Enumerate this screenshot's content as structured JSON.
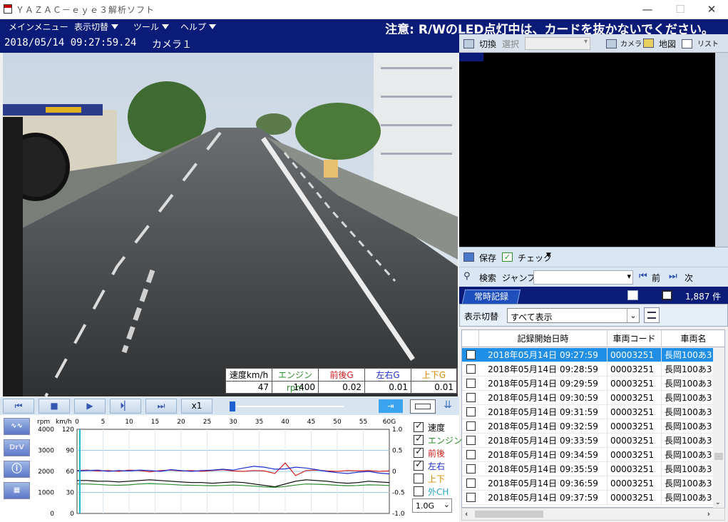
{
  "window": {
    "title": "ＹＡＺＡＣ－ｅｙｅ３解析ソフト",
    "minimize": "—",
    "maximize": "☐",
    "close": "✕"
  },
  "menu": {
    "items": [
      "メインメニュー",
      "表示切替",
      "ツール",
      "ヘルプ"
    ],
    "notice": "注意: R/WのLED点灯中は、カードを抜かないでください。"
  },
  "video": {
    "timestamp": "2018/05/14  09:27:59.24",
    "camera": "カメラ１"
  },
  "overlay": {
    "headers": [
      "速度km/h",
      "エンジン rpm",
      "前後G",
      "左右G",
      "上下G"
    ],
    "values": [
      "47",
      "1400",
      "0.02",
      "0.01",
      "0.01"
    ],
    "header_colors": [
      "#000000",
      "#2a8f2a",
      "#d42020",
      "#1e2ed0",
      "#e08a00"
    ]
  },
  "controls": {
    "speed": "x1",
    "buttons": [
      "⏮",
      "■",
      "▶",
      "⏵▏",
      "⏭"
    ]
  },
  "graph": {
    "left_units": [
      "rpm",
      "km/h"
    ],
    "rpm_ticks": [
      "4000",
      "3000",
      "2000",
      "1000",
      "0"
    ],
    "kmh_ticks": [
      "120",
      "90",
      "60",
      "30",
      "0"
    ],
    "g_ticks": [
      "1.0",
      "0.5",
      "0",
      "-0.5",
      "-1.0"
    ],
    "time_ticks": [
      "0",
      "5",
      "10",
      "15",
      "20",
      "25",
      "30",
      "35",
      "40",
      "45",
      "50",
      "55",
      "60G"
    ],
    "side_buttons": [
      "DrV"
    ],
    "legend": [
      {
        "label": "速度",
        "checked": true,
        "color": "#000000"
      },
      {
        "label": "エンジン",
        "checked": true,
        "color": "#2a8f2a"
      },
      {
        "label": "前後",
        "checked": true,
        "color": "#d42020"
      },
      {
        "label": "左右",
        "checked": true,
        "color": "#1e2ed0"
      },
      {
        "label": "上下",
        "checked": false,
        "color": "#e08a00"
      },
      {
        "label": "外CH",
        "checked": false,
        "color": "#2aa8c8"
      }
    ],
    "range_select": "1.0G"
  },
  "camera_toolbar": {
    "switch": "切換",
    "select": "選択",
    "camera": "カメラ",
    "map": "地図",
    "list": "リスト"
  },
  "save_bar": {
    "save": "保存",
    "check": "チェック"
  },
  "search_bar": {
    "search": "検索",
    "jump": "ジャンプ",
    "prev": "前",
    "next": "次"
  },
  "records_tab": {
    "label": "常時記録",
    "count": "1,887 件"
  },
  "filter": {
    "label": "表示切替",
    "value": "すべて表示"
  },
  "table": {
    "headers": [
      "記録開始日時",
      "車両コード",
      "車両名"
    ],
    "rows": [
      [
        "2018年05月14日 09:27:59",
        "00003251",
        "長岡100あ3"
      ],
      [
        "2018年05月14日 09:28:59",
        "00003251",
        "長岡100あ3"
      ],
      [
        "2018年05月14日 09:29:59",
        "00003251",
        "長岡100あ3"
      ],
      [
        "2018年05月14日 09:30:59",
        "00003251",
        "長岡100あ3"
      ],
      [
        "2018年05月14日 09:31:59",
        "00003251",
        "長岡100あ3"
      ],
      [
        "2018年05月14日 09:32:59",
        "00003251",
        "長岡100あ3"
      ],
      [
        "2018年05月14日 09:33:59",
        "00003251",
        "長岡100あ3"
      ],
      [
        "2018年05月14日 09:34:59",
        "00003251",
        "長岡100あ3"
      ],
      [
        "2018年05月14日 09:35:59",
        "00003251",
        "長岡100あ3"
      ],
      [
        "2018年05月14日 09:36:59",
        "00003251",
        "長岡100あ3"
      ],
      [
        "2018年05月14日 09:37:59",
        "00003251",
        "長岡100あ3"
      ]
    ]
  },
  "chart_data": {
    "type": "line",
    "x": [
      0,
      2,
      4,
      6,
      8,
      10,
      12,
      14,
      16,
      18,
      20,
      22,
      24,
      26,
      28,
      30,
      32,
      34,
      36,
      38,
      40,
      42,
      44,
      46,
      48,
      50,
      52,
      54,
      56,
      58,
      60
    ],
    "series": [
      {
        "name": "速度",
        "axis": "km/h",
        "values": [
          47,
          47,
          46,
          46,
          45,
          46,
          47,
          48,
          47,
          46,
          45,
          44,
          44,
          43,
          44,
          45,
          44,
          42,
          40,
          38,
          42,
          46,
          48,
          47,
          46,
          44,
          43,
          44,
          46,
          45,
          44
        ]
      },
      {
        "name": "エンジン",
        "axis": "rpm",
        "values": [
          1400,
          1400,
          1380,
          1350,
          1340,
          1360,
          1400,
          1420,
          1400,
          1380,
          1350,
          1340,
          1330,
          1320,
          1330,
          1350,
          1330,
          1300,
          1260,
          1240,
          1280,
          1350,
          1400,
          1390,
          1370,
          1340,
          1320,
          1330,
          1360,
          1350,
          1330
        ]
      },
      {
        "name": "前後",
        "axis": "G",
        "values": [
          0.02,
          0.03,
          0.01,
          0.02,
          0.0,
          0.03,
          0.02,
          -0.01,
          0.02,
          0.03,
          0.01,
          0.02,
          0.0,
          0.02,
          0.04,
          0.01,
          0.0,
          0.02,
          0.01,
          -0.05,
          0.2,
          -0.1,
          0.02,
          0.03,
          0.01,
          0.0,
          0.02,
          0.01,
          0.02,
          0.0,
          0.01
        ]
      },
      {
        "name": "左右",
        "axis": "G",
        "values": [
          0.01,
          0.02,
          0.03,
          0.0,
          0.02,
          0.01,
          0.03,
          0.02,
          0.0,
          0.04,
          0.02,
          0.0,
          0.02,
          0.03,
          0.05,
          0.03,
          0.08,
          0.12,
          0.1,
          0.05,
          0.06,
          0.1,
          0.08,
          0.04,
          0.0,
          -0.03,
          -0.05,
          -0.02,
          0.0,
          -0.04,
          -0.06
        ]
      }
    ],
    "rpm_range": [
      0,
      4000
    ],
    "kmh_range": [
      0,
      120
    ],
    "g_range": [
      -1.0,
      1.0
    ],
    "xlim": [
      0,
      60
    ]
  }
}
